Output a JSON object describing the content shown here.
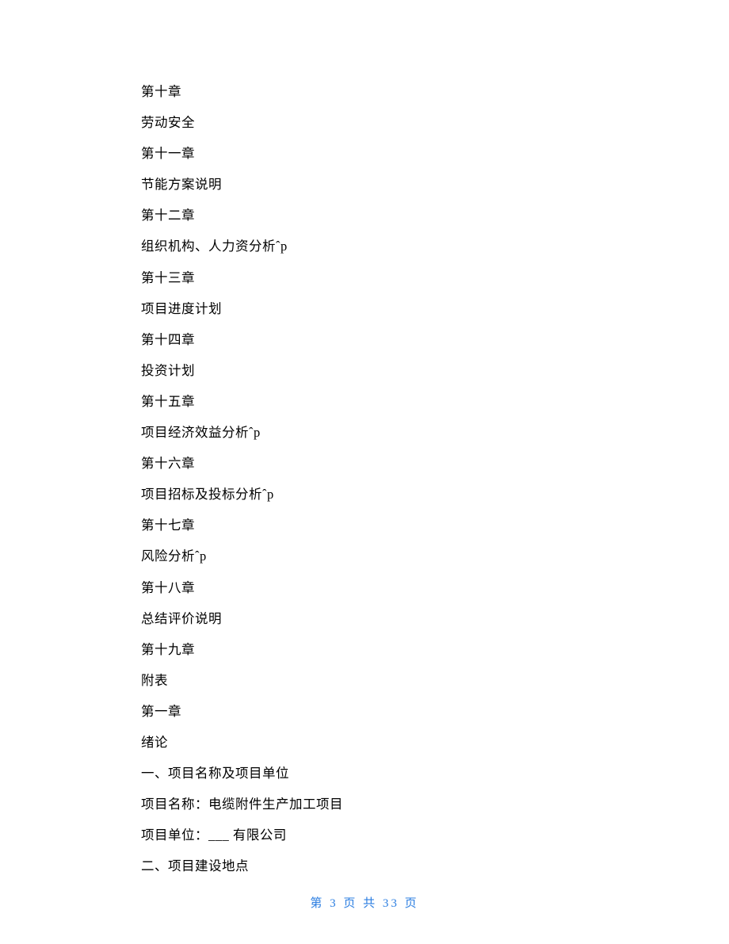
{
  "lines": [
    "第十章",
    "劳动安全",
    "第十一章",
    "节能方案说明",
    "第十二章",
    "组织机构、人力资分析ˆp",
    "第十三章",
    "项目进度计划",
    "第十四章",
    "投资计划",
    "第十五章",
    "项目经济效益分析ˆp",
    "第十六章",
    "项目招标及投标分析ˆp",
    "第十七章",
    "风险分析ˆp",
    "第十八章",
    "总结评价说明",
    "第十九章",
    "附表",
    "第一章",
    "绪论",
    "一、项目名称及项目单位",
    "项目名称：电缆附件生产加工项目",
    "项目单位：___ 有限公司",
    "二、项目建设地点"
  ],
  "footer": {
    "text": "第 3 页 共 33 页"
  }
}
